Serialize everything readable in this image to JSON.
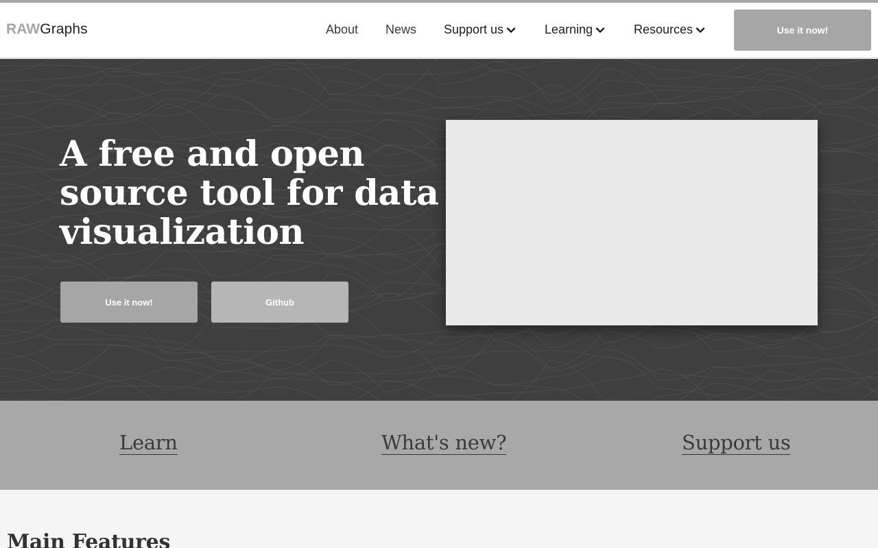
{
  "brand": {
    "logo_bold": "RAW",
    "logo_light": "Graphs"
  },
  "nav": {
    "items": [
      {
        "label": "About",
        "has_dropdown": false
      },
      {
        "label": "News",
        "has_dropdown": false
      },
      {
        "label": "Support us",
        "has_dropdown": true
      },
      {
        "label": "Learning",
        "has_dropdown": true
      },
      {
        "label": "Resources",
        "has_dropdown": true
      }
    ],
    "cta_label": "Use it now!"
  },
  "hero": {
    "title": "A free and open source tool for data visualization",
    "primary_button": "Use it now!",
    "secondary_button": "Github"
  },
  "quick_links": [
    "Learn",
    "What's new?",
    "Support us"
  ],
  "sections": {
    "features_title": "Main Features"
  },
  "colors": {
    "accent_gray": "#a6a6a6",
    "hero_bg": "#3f3f3f",
    "band_bg": "#a8a8a8",
    "page_bg": "#f5f5f5"
  }
}
